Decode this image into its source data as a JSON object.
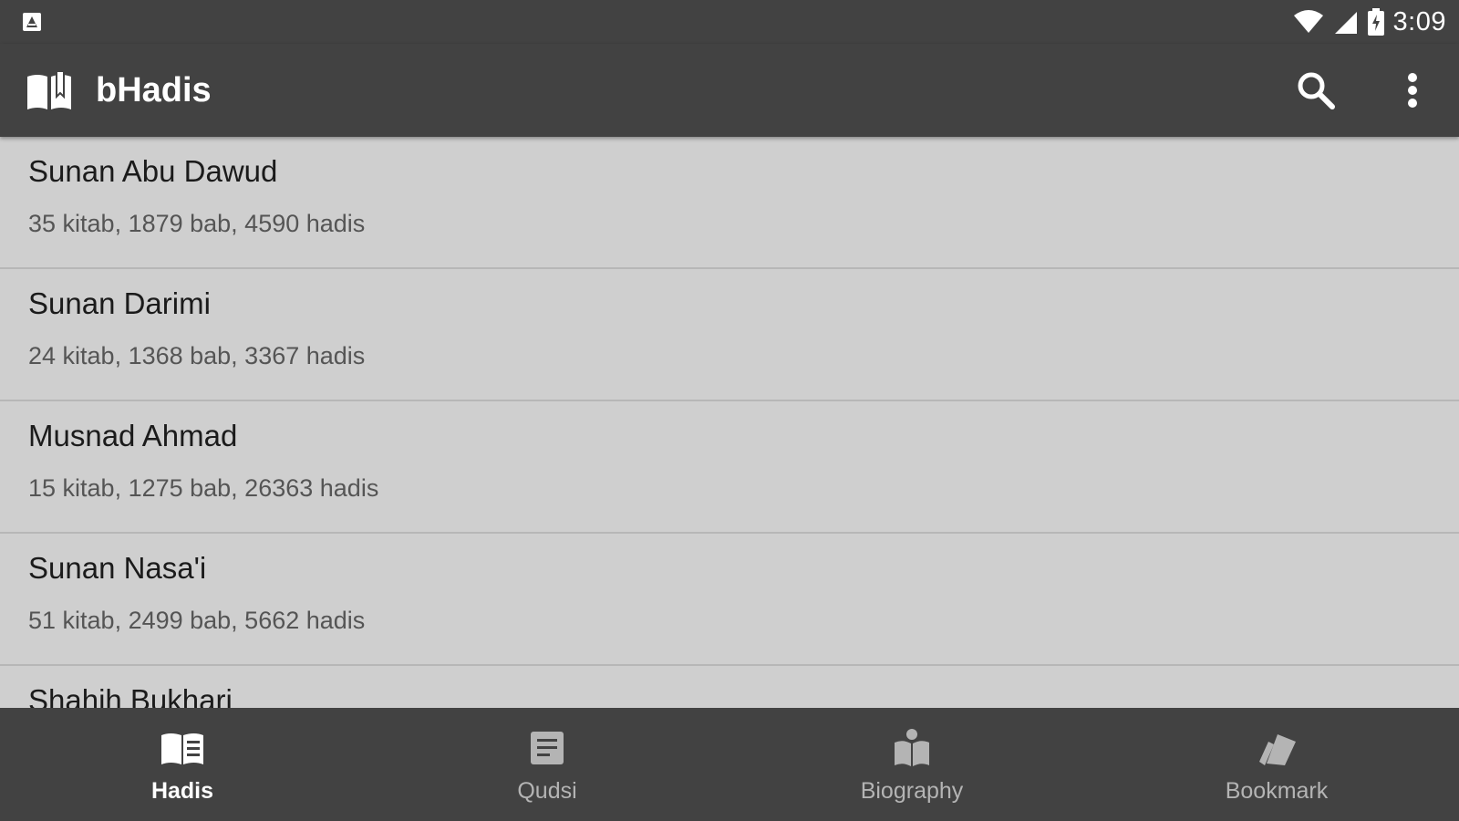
{
  "status_bar": {
    "time": "3:09",
    "icons": [
      "notification-icon",
      "wifi-icon",
      "cell-signal-icon",
      "battery-icon"
    ]
  },
  "app_bar": {
    "title": "bHadis",
    "logo_icon": "open-book-icon",
    "actions": [
      "search-icon",
      "more-vert-icon"
    ]
  },
  "books": [
    {
      "title": "Sunan Abu Dawud",
      "meta": "35 kitab, 1879 bab, 4590 hadis"
    },
    {
      "title": "Sunan Darimi",
      "meta": "24 kitab, 1368 bab, 3367 hadis"
    },
    {
      "title": "Musnad Ahmad",
      "meta": "15 kitab, 1275 bab, 26363 hadis"
    },
    {
      "title": "Sunan Nasa'i",
      "meta": "51 kitab, 2499 bab, 5662 hadis"
    },
    {
      "title": "Shahih Bukhari",
      "meta": ""
    }
  ],
  "bottom_nav": {
    "active_tab": "Hadis",
    "tabs": [
      {
        "label": "Hadis",
        "icon": "book-icon"
      },
      {
        "label": "Qudsi",
        "icon": "document-icon"
      },
      {
        "label": "Biography",
        "icon": "reader-icon"
      },
      {
        "label": "Bookmark",
        "icon": "bookmark-stack-icon"
      }
    ]
  },
  "colors": {
    "toolbar": "#424242",
    "list_background": "#cfcfcf",
    "divider": "#b7b7b7",
    "title_text": "#1b1b1b",
    "meta_text": "#555555",
    "inactive_tab": "#b4b4b4",
    "active_tab": "#ffffff"
  }
}
